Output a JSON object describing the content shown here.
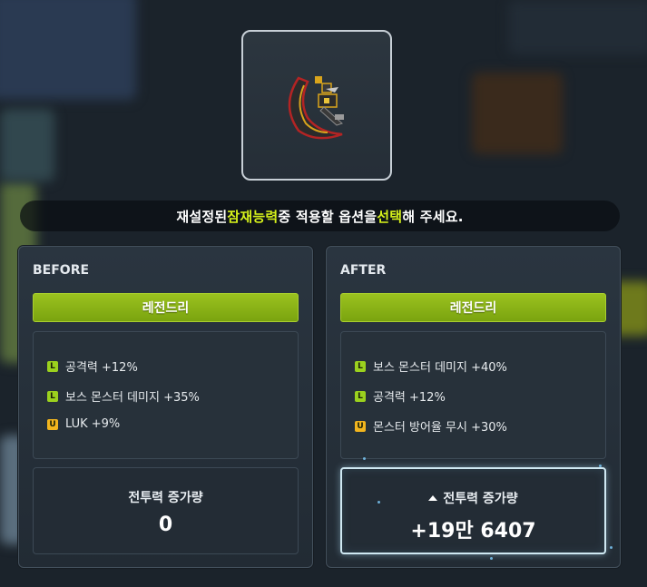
{
  "prompt": {
    "part1": "재설정된 ",
    "highlight1": "잠재능력",
    "part2": " 중 적용할 옵션을 ",
    "highlight2": "선택",
    "part3": "해 주세요."
  },
  "item": {
    "icon": "scythe-weapon-icon"
  },
  "before": {
    "title": "BEFORE",
    "grade": "레전드리",
    "options": [
      {
        "grade_badge": "L",
        "text": "공격력 +12%"
      },
      {
        "grade_badge": "L",
        "text": "보스 몬스터 데미지 +35%"
      },
      {
        "grade_badge": "U",
        "text": "LUK +9%"
      }
    ],
    "power_label": "전투력 증가량",
    "power_value": "0"
  },
  "after": {
    "title": "AFTER",
    "grade": "레전드리",
    "options": [
      {
        "grade_badge": "L",
        "text": "보스 몬스터 데미지 +40%"
      },
      {
        "grade_badge": "L",
        "text": "공격력 +12%"
      },
      {
        "grade_badge": "U",
        "text": "몬스터 방어율 무시 +30%"
      }
    ],
    "power_label": "전투력 증가량",
    "power_value": "+19만 6407"
  },
  "colors": {
    "legendary_badge": "#9bd11e",
    "unique_badge": "#f2b51e",
    "highlight": "#d7f21b",
    "grade_bar": "#8cb319"
  }
}
